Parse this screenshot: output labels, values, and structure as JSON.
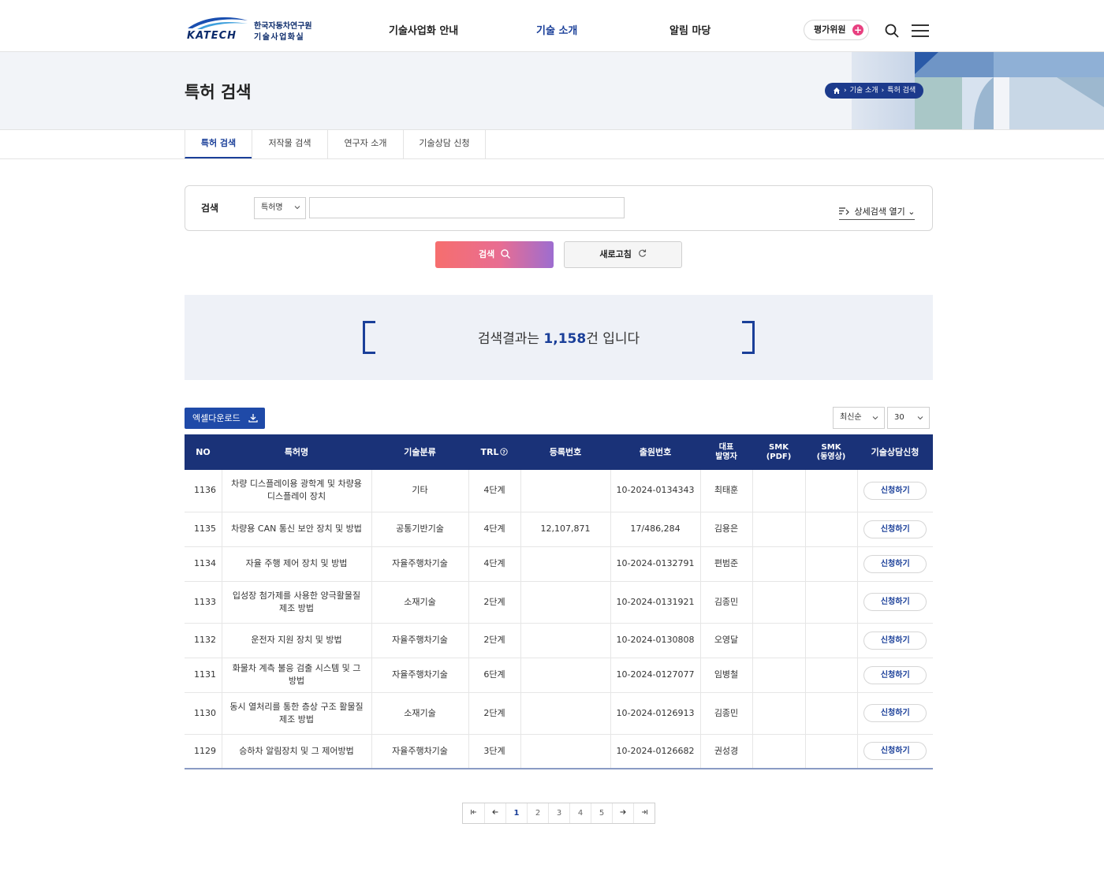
{
  "header": {
    "logo_en": "KATECH",
    "logo_ko1": "한국자동차연구원",
    "logo_ko2": "기술사업화실",
    "nav": [
      "기술사업화 안내",
      "기술 소개",
      "알림 마당"
    ],
    "eval_button": "평가위원",
    "search_icon": "search-icon",
    "menu_icon": "hamburger-icon"
  },
  "subvisual": {
    "title": "특허 검색",
    "breadcrumb": [
      "기술 소개",
      "특허 검색"
    ]
  },
  "tabs": [
    "특허 검색",
    "저작물 검색",
    "연구자 소개",
    "기술상담 신청"
  ],
  "search": {
    "label": "검색",
    "field_select": "특허명",
    "query": "",
    "advanced_toggle": "상세검색 열기",
    "search_button": "검색",
    "reset_button": "새로고침"
  },
  "result": {
    "prefix": "검색결과는 ",
    "count": "1,158",
    "suffix": "건 입니다"
  },
  "controls": {
    "excel_button": "엑셀다운로드",
    "sort": "최신순",
    "page_size": "30"
  },
  "table": {
    "headers": [
      "NO",
      "특허명",
      "기술분류",
      "TRL",
      "등록번호",
      "출원번호",
      "대표\n발명자",
      "SMK\n(PDF)",
      "SMK\n(동영상)",
      "기술상담신청"
    ],
    "apply_label": "신청하기",
    "rows": [
      {
        "no": "1136",
        "name": "차량 디스플레이용 광학계 및 차량용 디스플레이 장치",
        "category": "기타",
        "trl": "4단계",
        "reg_no": "",
        "app_no": "10-2024-0134343",
        "inventor": "최태훈"
      },
      {
        "no": "1135",
        "name": "차량용 CAN 통신 보안 장치 및 방법",
        "category": "공통기반기술",
        "trl": "4단계",
        "reg_no": "12,107,871",
        "app_no": "17/486,284",
        "inventor": "김용은"
      },
      {
        "no": "1134",
        "name": "자율 주행 제어 장치 및 방법",
        "category": "자율주행차기술",
        "trl": "4단계",
        "reg_no": "",
        "app_no": "10-2024-0132791",
        "inventor": "편범준"
      },
      {
        "no": "1133",
        "name": "입성장 첨가제를 사용한 양극활물질 제조 방법",
        "category": "소재기술",
        "trl": "2단계",
        "reg_no": "",
        "app_no": "10-2024-0131921",
        "inventor": "김종민"
      },
      {
        "no": "1132",
        "name": "운전자 지원 장치 및 방법",
        "category": "자율주행차기술",
        "trl": "2단계",
        "reg_no": "",
        "app_no": "10-2024-0130808",
        "inventor": "오영달"
      },
      {
        "no": "1131",
        "name": "화물차 계측 불응 검출 시스템 및 그 방법",
        "category": "자율주행차기술",
        "trl": "6단계",
        "reg_no": "",
        "app_no": "10-2024-0127077",
        "inventor": "임병철"
      },
      {
        "no": "1130",
        "name": "동시 열처리를 통한 층상 구조 활물질 제조 방법",
        "category": "소재기술",
        "trl": "2단계",
        "reg_no": "",
        "app_no": "10-2024-0126913",
        "inventor": "김종민"
      },
      {
        "no": "1129",
        "name": "승하차 알림장치 및 그 제어방법",
        "category": "자율주행차기술",
        "trl": "3단계",
        "reg_no": "",
        "app_no": "10-2024-0126682",
        "inventor": "권성경"
      }
    ]
  },
  "pagination": {
    "pages": [
      "1",
      "2",
      "3",
      "4",
      "5"
    ],
    "current": "1"
  },
  "colors": {
    "primary": "#1a3f99",
    "table_header": "#1a3278",
    "accent_pink": "#e84080"
  }
}
